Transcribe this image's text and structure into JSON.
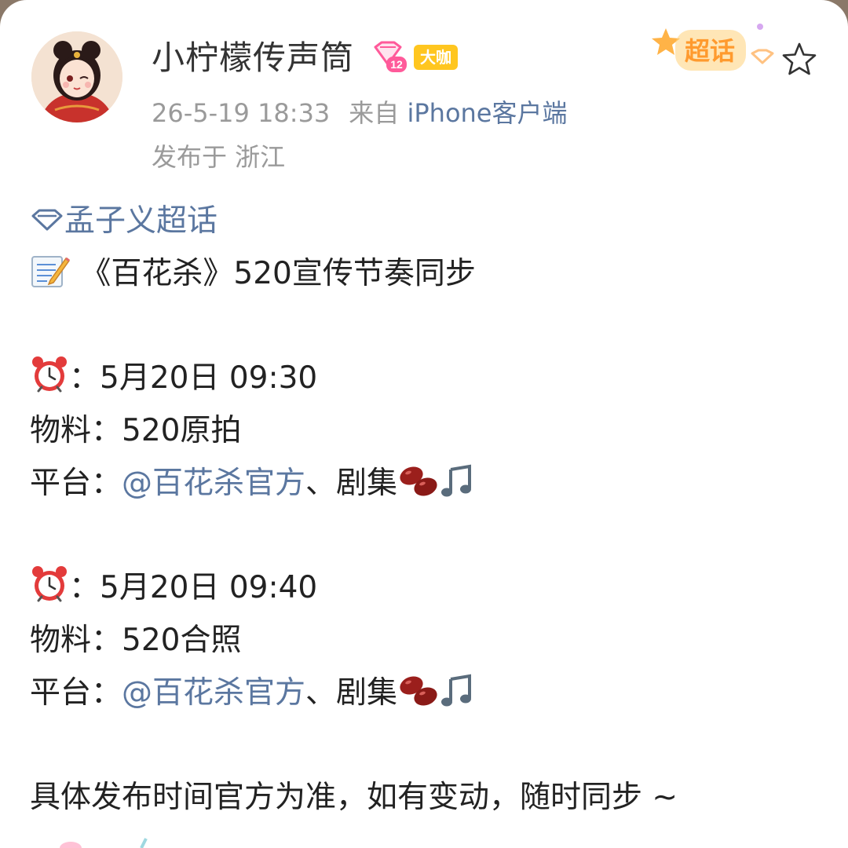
{
  "post": {
    "author": {
      "name": "小柠檬传声筒",
      "level_badge": "12",
      "role_badge": "大咖"
    },
    "time": "26-5-19 18:33",
    "source_prefix": "来自",
    "source_client": "iPhone客户端",
    "location": "发布于 浙江",
    "super_topic_button": "超话",
    "topic": "孟子义超话",
    "title": "《百花杀》520宣传节奏同步",
    "schedule": [
      {
        "time_label": "：",
        "time": "5月20日 09:30",
        "material_label": "物料：",
        "material": "520原拍",
        "platform_label": "平台：",
        "platform_link": "@百花杀官方",
        "platform_rest": "、剧集"
      },
      {
        "time_label": "：",
        "time": "5月20日 09:40",
        "material_label": "物料：",
        "material": "520合照",
        "platform_label": "平台：",
        "platform_link": "@百花杀官方",
        "platform_rest": "、剧集"
      }
    ],
    "footer": "具体发布时间官方为准，如有变动，随时同步 ~"
  },
  "icons": {
    "avatar": "avatar-image",
    "level": "diamond-level-icon",
    "topic": "diamond-topic-icon",
    "memo": "memo-icon",
    "clock": "alarm-clock-icon",
    "beans": "bean-icon",
    "music": "music-note-icon",
    "star": "star-icon"
  },
  "colors": {
    "link": "#5b77a0",
    "text": "#222222",
    "meta": "#9a9a9a",
    "role_badge": "#ffc61f",
    "level_badge": "#ff5a9a"
  }
}
